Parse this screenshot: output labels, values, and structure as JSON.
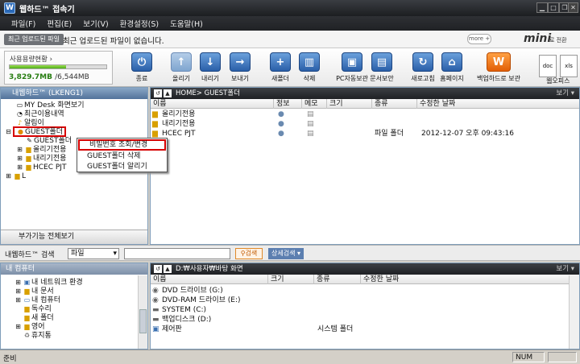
{
  "window": {
    "title": "웹하드™ 접속기",
    "icon_text": "W",
    "controls": [
      "minimize-icon",
      "maximize-icon",
      "restore-icon",
      "close-icon"
    ]
  },
  "menu": [
    "파일(F)",
    "편집(E)",
    "보기(V)",
    "환경설정(S)",
    "도움말(H)"
  ],
  "notice": {
    "tag": "최근 업로드된 파일",
    "text": "최근 업로드된 파일이 없습니다.",
    "more": "more +",
    "logo": "mini",
    "logo_sub": "로 전환"
  },
  "usage": {
    "label": "사용용량현황 ›",
    "used": "3,829.7MB",
    "total": "/6,544MB",
    "fraction": 0.585
  },
  "toolbar": [
    {
      "label": "종료",
      "icon": "power-icon"
    },
    {
      "label": "올리기",
      "icon": "arrow-up-icon"
    },
    {
      "label": "내리기",
      "icon": "arrow-down-icon"
    },
    {
      "label": "보내기",
      "icon": "arrow-right-icon"
    },
    {
      "label": "새폴더",
      "icon": "new-folder-icon"
    },
    {
      "label": "삭제",
      "icon": "trash-icon"
    },
    {
      "label": "PC자동보관",
      "icon": "pc-backup-icon"
    },
    {
      "label": "문서보안",
      "icon": "document-lock-icon"
    },
    {
      "label": "새로고침",
      "icon": "refresh-icon"
    },
    {
      "label": "홈페이지",
      "icon": "home-icon"
    },
    {
      "label": "백업하드로 보관",
      "icon": "backup-hard-icon"
    },
    {
      "label": "웹오피스",
      "icon": "web-office-icon"
    }
  ],
  "doc_icons": [
    "doc",
    "xls"
  ],
  "left_tree": {
    "header": "내웹하드™ (LKENG1)",
    "items": [
      {
        "label": "MY Desk 화면보기",
        "icon": "monitor-icon"
      },
      {
        "label": "최근이용내역",
        "icon": "history-icon"
      },
      {
        "label": "알림이",
        "icon": "bell-icon"
      },
      {
        "label": "GUEST폴더",
        "icon": "guest-folder-icon"
      },
      {
        "label": "GUEST폴더",
        "icon": "pencil-icon"
      },
      {
        "label": "올리기전용",
        "icon": "upload-folder-icon"
      },
      {
        "label": "내리기전용",
        "icon": "download-folder-icon"
      },
      {
        "label": "HCEC PJT",
        "icon": "folder-icon"
      },
      {
        "label": "L",
        "icon": "folder-icon"
      }
    ],
    "footer": "부가기능 전체보기"
  },
  "context_menu": [
    "비밀번호 조회/변경",
    "GUEST폴더 삭제",
    "GUEST폴더 알리기"
  ],
  "right_top": {
    "path": "HOME> GUEST폴더",
    "view": "보기 ▾",
    "columns": [
      "이름",
      "정보",
      "메모",
      "크기",
      "종류",
      "수정한 날짜"
    ],
    "rows": [
      {
        "name": "올리기전용",
        "type": "",
        "date": ""
      },
      {
        "name": "내리기전용",
        "type": "",
        "date": ""
      },
      {
        "name": "HCEC PJT",
        "type": "파일 폴더",
        "date": "2012-12-07 오후 09:43:16"
      }
    ]
  },
  "search": {
    "label": "내웹하드™ 검색",
    "scope": "파일",
    "button": "검색",
    "detail": "상세검색 ▾"
  },
  "left_bottom": {
    "header": "내 컴퓨터",
    "items": [
      "내 네트워크 환경",
      "내 문서",
      "내 컴퓨터",
      "독수리",
      "새 폴더",
      "영어",
      "휴지통"
    ]
  },
  "right_bottom": {
    "path": "D:₩사용자₩바탕 화면",
    "view": "보기 ▾",
    "columns": [
      "이름",
      "크기",
      "종류",
      "수정한 날짜"
    ],
    "rows": [
      {
        "name": "DVD 드라이브 (G:)",
        "type": ""
      },
      {
        "name": "DVD-RAM 드라이브 (E:)",
        "type": ""
      },
      {
        "name": "SYSTEM (C:)",
        "type": ""
      },
      {
        "name": "백업디스크 (D:)",
        "type": ""
      },
      {
        "name": "제어판",
        "type": "시스템 폴더"
      }
    ]
  },
  "status": {
    "left": "준비",
    "num": "NUM"
  },
  "colors": {
    "accent_blue": "#2a5fa8",
    "highlight_red": "#d60000",
    "usage_green": "#4fae17"
  }
}
